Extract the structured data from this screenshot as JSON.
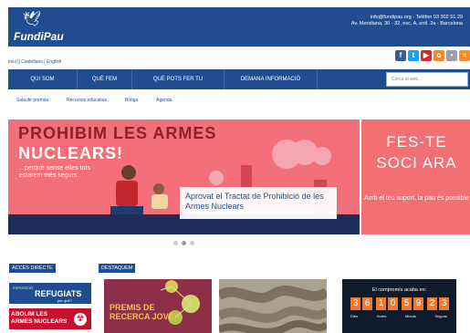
{
  "header": {
    "logo_text": "FundiPau",
    "contact_line1": "info@fundipau.org - Telèfon 93 302 51 29",
    "contact_line2": "Av. Meridiana, 30 - 32, esc. A, entl. 2a - Barcelona"
  },
  "languages": {
    "text": "Inici || Castellano | English"
  },
  "social": [
    {
      "name": "facebook-icon",
      "label": "f",
      "color": "#3b5998"
    },
    {
      "name": "twitter-icon",
      "label": "t",
      "color": "#1da1f2"
    },
    {
      "name": "youtube-icon",
      "label": "▶",
      "color": "#d9252a"
    },
    {
      "name": "issuu-icon",
      "label": "o",
      "color": "#ef8b2c"
    },
    {
      "name": "flickr-icon",
      "label": "•",
      "color": "#9aa0a6"
    },
    {
      "name": "rss-icon",
      "label": "≈",
      "color": "#f28c28"
    }
  ],
  "nav": {
    "items": [
      "QUI SOM",
      "QUÈ FEM",
      "QUÈ POTS FER TU",
      "DEMANA INFORMACIÓ"
    ],
    "search_placeholder": "Cerca al web..."
  },
  "subnav": [
    "Sala de premsa",
    "Recursos educatius",
    "Botiga",
    "Agenda"
  ],
  "slider": {
    "title_red": "PROHIBIM LES ARMES",
    "title_white": "NUCLEARS!",
    "subtitle": "...perquè sense elles tots estarem més segurs.",
    "caption": "Aprovat el Tractat de Prohibició de les Armes Nuclears",
    "cta_line1": "FES-TE",
    "cta_line2": "SOCI ARA",
    "cta_sub": "Amb el teu suport, la pau és possible",
    "dots": 3,
    "active_dot": 1
  },
  "access": {
    "label": "ACCÉS DIRECTE",
    "refugiats_small": "EXPOSICIÓ",
    "refugiats": "REFUGIATS",
    "refugiats_sub": "per què?",
    "abolim": "ABOLIM LES ARMES NUCLEARS"
  },
  "featured": {
    "label": "DESTAQUEM",
    "card1_line1": "PREMIS DE",
    "card1_line2": "RECERCA JOVE",
    "countdown_title": "El compromís acaba en:",
    "digits": [
      "3",
      "6",
      "1",
      "0",
      "5",
      "9",
      "2",
      "3"
    ],
    "units": [
      "Dies",
      "Hores",
      "Minuts",
      "Segons"
    ]
  }
}
